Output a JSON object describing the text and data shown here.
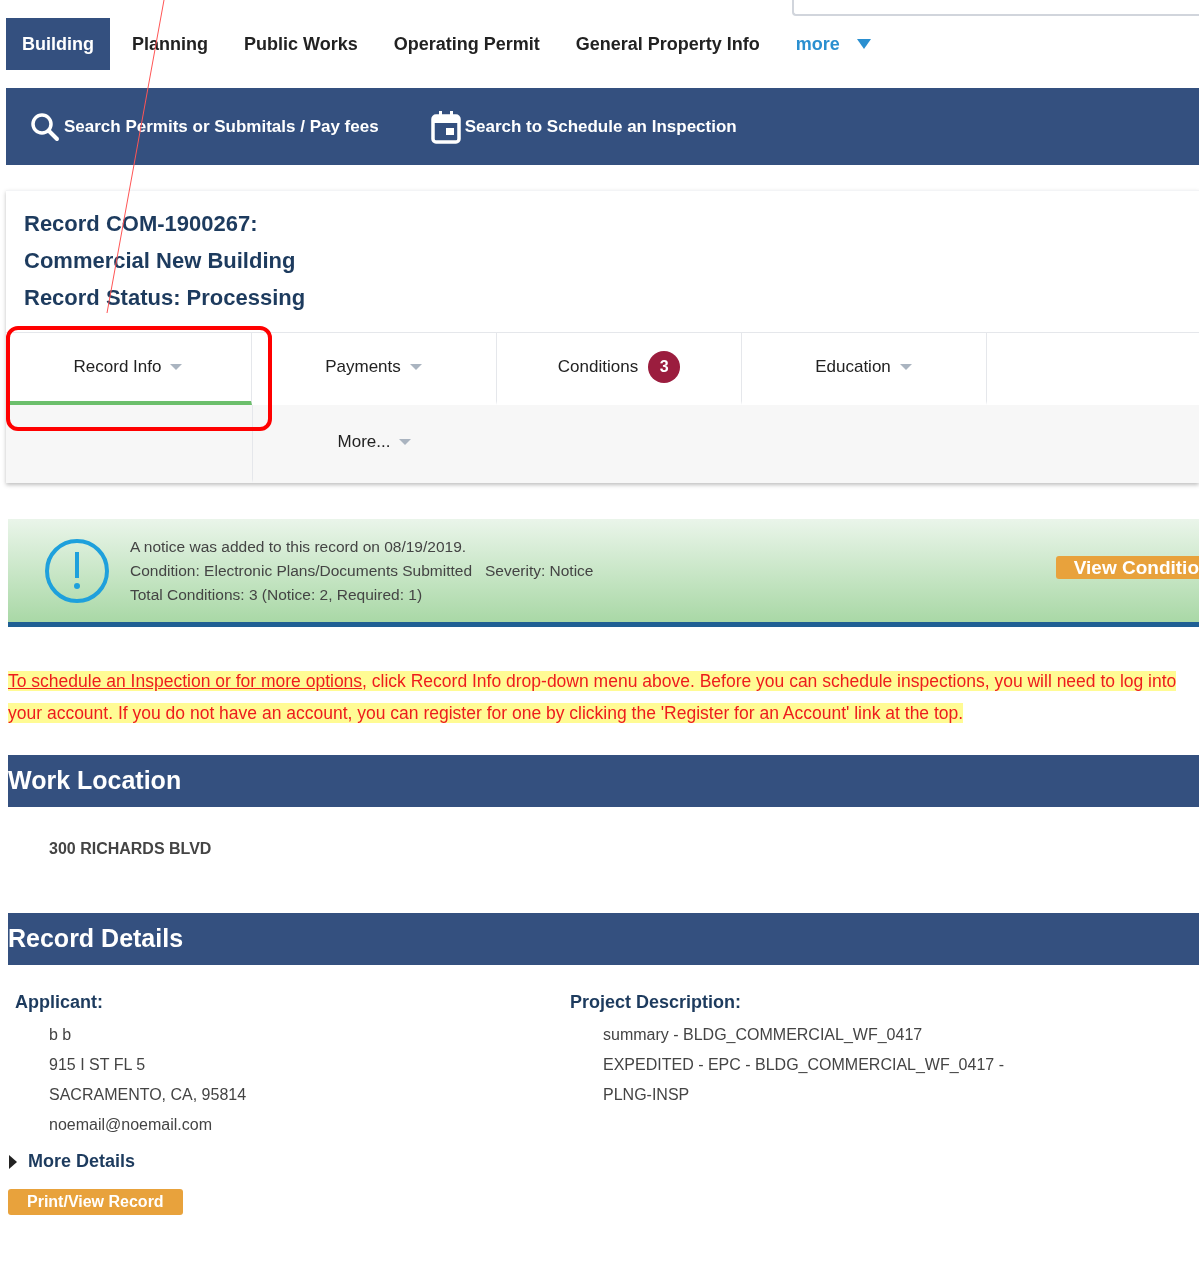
{
  "top_nav": {
    "items": [
      {
        "label": "Building",
        "selected": true
      },
      {
        "label": "Planning",
        "selected": false
      },
      {
        "label": "Public Works",
        "selected": false
      },
      {
        "label": "Operating Permit",
        "selected": false
      },
      {
        "label": "General Property Info",
        "selected": false
      }
    ],
    "more": "more"
  },
  "action_bar": [
    {
      "kind": "search",
      "label": "Search Permits or Submitals / Pay fees"
    },
    {
      "kind": "calendar",
      "label": "Search to Schedule an Inspection"
    }
  ],
  "record_header": [
    "Record COM-1900267:",
    "Commercial New Building",
    "Record Status: Processing"
  ],
  "record_tabs": [
    {
      "label": "Record Info",
      "selected": true,
      "dropdown": true
    },
    {
      "label": "Payments",
      "selected": false,
      "dropdown": true
    },
    {
      "label": "Conditions",
      "selected": false,
      "dropdown": false,
      "badge": "3"
    },
    {
      "label": "Education",
      "selected": false,
      "dropdown": true
    },
    {
      "label": "More...",
      "selected": false,
      "dropdown": true
    }
  ],
  "notice": {
    "lines": [
      "A notice was added to this record on 08/19/2019.",
      "Condition: Electronic Plans/Documents Submitted   Severity: Notice",
      "Total Conditions: 3 (Notice: 2, Required: 1)"
    ],
    "button": "View Conditio"
  },
  "instruction": {
    "link": "To schedule an Inspection or for more options",
    "text": ", click Record Info drop-down menu above.  Before you can schedule inspections, you will need to log into your account.  If you do not have an account, you can register for one by clicking the 'Register for an Account' link at the top."
  },
  "work_location": {
    "title": "Work Location",
    "address": "300 RICHARDS BLVD"
  },
  "record_details": {
    "title": "Record Details",
    "applicant": {
      "label": "Applicant:",
      "lines": [
        "b b",
        "915 I ST FL 5",
        "SACRAMENTO, CA, 95814",
        "noemail@noemail.com"
      ]
    },
    "project_description": {
      "label": "Project Description:",
      "lines": [
        "summary - BLDG_COMMERCIAL_WF_0417",
        "EXPEDITED - EPC - BLDG_COMMERCIAL_WF_0417 -",
        "PLNG-INSP"
      ]
    },
    "more_details": "More Details",
    "print_button": "Print/View Record"
  }
}
